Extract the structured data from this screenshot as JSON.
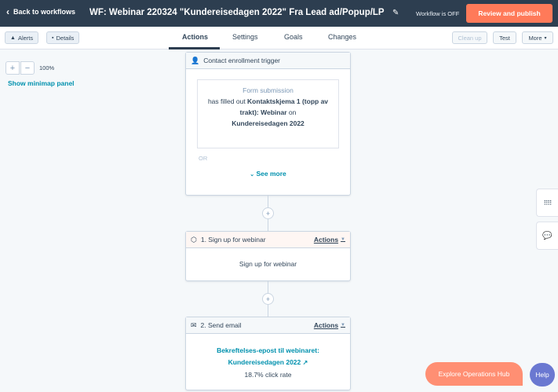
{
  "topbar": {
    "back_label": "Back to workflows",
    "title": "WF: Webinar 220324 \"Kundereisedagen 2022\" Fra Lead ad/Popup/LP",
    "status": "Workflow is OFF",
    "publish_label": "Review and publish"
  },
  "subnav": {
    "alerts_label": "Alerts",
    "details_label": "Details",
    "tabs": [
      {
        "label": "Actions"
      },
      {
        "label": "Settings"
      },
      {
        "label": "Goals"
      },
      {
        "label": "Changes"
      }
    ],
    "cleanup_label": "Clean up",
    "test_label": "Test",
    "more_label": "More"
  },
  "zoom": {
    "plus": "+",
    "minus": "−",
    "level": "100%",
    "minimap_label": "Show minimap panel"
  },
  "trigger": {
    "header": "Contact enrollment trigger",
    "box_type": "Form submission",
    "line_pre": "has filled out ",
    "form_name": "Kontaktskjema 1 (topp av trakt): Webinar",
    "line_mid": " on",
    "page_name": "Kundereisedagen 2022",
    "or_label": "OR",
    "see_more": "See more"
  },
  "step1": {
    "header": "1. Sign up for webinar",
    "actions_label": "Actions",
    "body": "Sign up for webinar"
  },
  "step2": {
    "header": "2. Send email",
    "actions_label": "Actions",
    "email_line1": "Bekreftelses-epost til webinaret:",
    "email_line2": "Kundereisedagen 2022",
    "click_rate": "18.7% click rate"
  },
  "widgets": {
    "ops_hub_label": "Explore Operations Hub",
    "help_label": "Help"
  },
  "colors": {
    "topbar": "#2d3e50",
    "accent": "#ff7a59",
    "link": "#0091ae",
    "help": "#6a78d1"
  }
}
